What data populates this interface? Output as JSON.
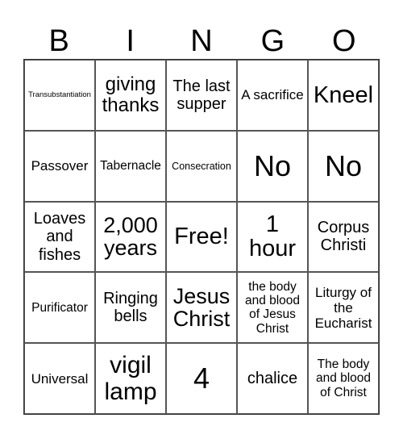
{
  "header": [
    "B",
    "I",
    "N",
    "G",
    "O"
  ],
  "cells": [
    [
      "Transubstantiation",
      "giving thanks",
      "The last supper",
      "A sacrifice",
      "Kneel"
    ],
    [
      "Passover",
      "Tabernacle",
      "Consecration",
      "No",
      "No"
    ],
    [
      "Loaves and fishes",
      "2,000 years",
      "Free!",
      "1 hour",
      "Corpus Christi"
    ],
    [
      "Purificator",
      "Ringing bells",
      "Jesus Christ",
      "the body and blood of Jesus Christ",
      "Liturgy of the Eucharist"
    ],
    [
      "Universal",
      "vigil lamp",
      "4",
      "chalice",
      "The body and blood of Christ"
    ]
  ]
}
